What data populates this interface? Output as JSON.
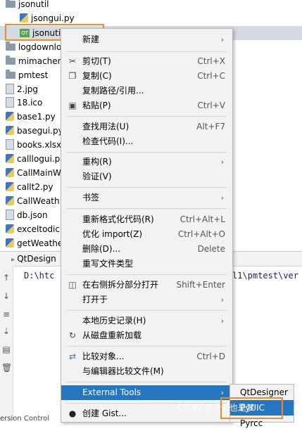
{
  "tree": {
    "items": [
      {
        "label": "jsonutil",
        "icon": "folder"
      },
      {
        "label": "jsongui.py",
        "icon": "py"
      },
      {
        "label": "jsonuti",
        "icon": "qt-ui"
      },
      {
        "label": "logdownlo",
        "icon": "folder"
      },
      {
        "label": "mimachen",
        "icon": "folder"
      },
      {
        "label": "pmtest",
        "icon": "folder"
      },
      {
        "label": "2.jpg",
        "icon": "file"
      },
      {
        "label": "18.ico",
        "icon": "file"
      },
      {
        "label": "base1.py",
        "icon": "py"
      },
      {
        "label": "basegui.py",
        "icon": "py"
      },
      {
        "label": "books.xlsx",
        "icon": "file"
      },
      {
        "label": "calllogui.p",
        "icon": "py"
      },
      {
        "label": "CallMainW",
        "icon": "py"
      },
      {
        "label": "callt2.py",
        "icon": "py"
      },
      {
        "label": "CallWeath",
        "icon": "py"
      },
      {
        "label": "db.json",
        "icon": "file"
      },
      {
        "label": "exceltodic",
        "icon": "py"
      },
      {
        "label": "getWeathe",
        "icon": "py"
      }
    ]
  },
  "run": {
    "tab_label": "QtDesign",
    "console_text": "D:\\htc",
    "console_text_right": "l1\\pmtest\\ver",
    "status_text": "ersion Control"
  },
  "menu": {
    "items": [
      {
        "label": "新建",
        "shortcut": "",
        "submenu": true,
        "icon": ""
      },
      {
        "label": "剪切(T)",
        "shortcut": "Ctrl+X",
        "submenu": false,
        "icon": "scissors-icon"
      },
      {
        "label": "复制(C)",
        "shortcut": "Ctrl+C",
        "submenu": false,
        "icon": "copy-icon"
      },
      {
        "label": "复制路径/引用...",
        "shortcut": "",
        "submenu": false,
        "icon": ""
      },
      {
        "label": "粘贴(P)",
        "shortcut": "Ctrl+V",
        "submenu": false,
        "icon": "paste-icon"
      },
      {
        "label": "查找用法(U)",
        "shortcut": "Alt+F7",
        "submenu": false,
        "icon": ""
      },
      {
        "label": "检查代码(I)...",
        "shortcut": "",
        "submenu": false,
        "icon": ""
      },
      {
        "label": "重构(R)",
        "shortcut": "",
        "submenu": true,
        "icon": ""
      },
      {
        "label": "验证(V)",
        "shortcut": "",
        "submenu": false,
        "icon": ""
      },
      {
        "label": "书签",
        "shortcut": "",
        "submenu": true,
        "icon": ""
      },
      {
        "label": "重新格式化代码(R)",
        "shortcut": "Ctrl+Alt+L",
        "submenu": false,
        "icon": ""
      },
      {
        "label": "优化 import(Z)",
        "shortcut": "Ctrl+Alt+O",
        "submenu": false,
        "icon": ""
      },
      {
        "label": "删除(D)...",
        "shortcut": "Delete",
        "submenu": false,
        "icon": ""
      },
      {
        "label": "重写文件类型",
        "shortcut": "",
        "submenu": false,
        "icon": ""
      },
      {
        "label": "在右侧拆分部分打开",
        "shortcut": "Shift+Enter",
        "submenu": false,
        "icon": "split-icon"
      },
      {
        "label": "打开于",
        "shortcut": "",
        "submenu": true,
        "icon": ""
      },
      {
        "label": "本地历史记录(H)",
        "shortcut": "",
        "submenu": true,
        "icon": ""
      },
      {
        "label": "从磁盘重新加载",
        "shortcut": "",
        "submenu": false,
        "icon": "reload-icon"
      },
      {
        "label": "比较对象...",
        "shortcut": "Ctrl+D",
        "submenu": false,
        "icon": "compare-icon"
      },
      {
        "label": "与编辑器比较文件(M)",
        "shortcut": "",
        "submenu": false,
        "icon": ""
      },
      {
        "label": "External Tools",
        "shortcut": "",
        "submenu": true,
        "icon": ""
      },
      {
        "label": "创建 Gist...",
        "shortcut": "",
        "submenu": false,
        "icon": "github-icon"
      }
    ],
    "arrow": "›"
  },
  "submenu": {
    "items": [
      {
        "label": "QtDesigner"
      },
      {
        "label": "PyUIC"
      },
      {
        "label": "Pyrcc"
      }
    ]
  },
  "watermark": "CSDN @今天也是梦",
  "colors": {
    "selection": "#2675bf",
    "highlight_box": "#f08a24",
    "menu_bg": "#f2f2f2"
  }
}
